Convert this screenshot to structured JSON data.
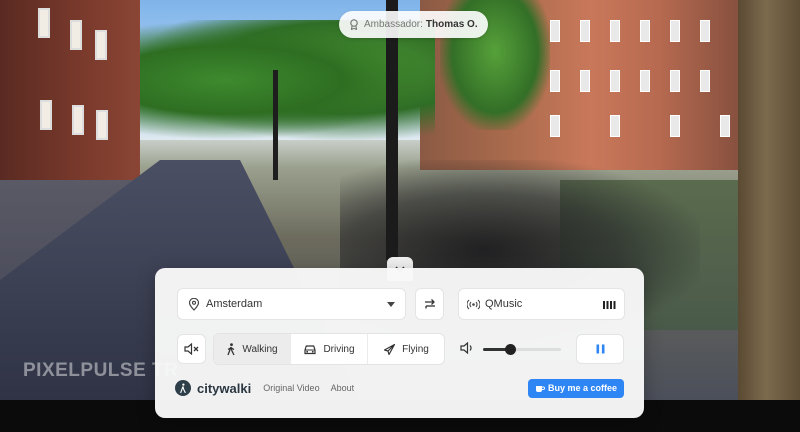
{
  "watermark": "PIXELPULSE TR",
  "ambassador": {
    "label": "Ambassador:",
    "name": "Thomas O."
  },
  "location": {
    "selected": "Amsterdam"
  },
  "radio": {
    "label": "QMusic"
  },
  "modes": [
    {
      "label": "Walking",
      "icon": "walking-icon",
      "active": true
    },
    {
      "label": "Driving",
      "icon": "car-icon",
      "active": false
    },
    {
      "label": "Flying",
      "icon": "plane-icon",
      "active": false
    }
  ],
  "volume": {
    "level": 0.35
  },
  "footer": {
    "brand": "citywalki",
    "links": [
      "Original Video",
      "About"
    ],
    "coffee_label": "Buy me a coffee"
  },
  "colors": {
    "accent": "#2e86f5",
    "brand": "#2f3f4a"
  }
}
